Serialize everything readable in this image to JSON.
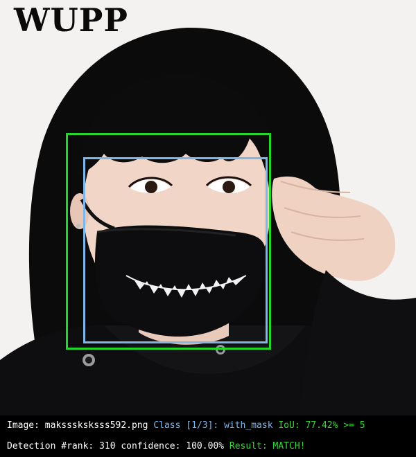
{
  "logo_text": "WUPP",
  "colors": {
    "ground_truth_box": "#22d62a",
    "prediction_box": "#7db6e8",
    "info_text": "#ffffff",
    "class_text": "#7eb8ef",
    "match_text": "#38d63a",
    "info_bar_bg": "#000000"
  },
  "info": {
    "image_label": "Image: maksssksksss592.png",
    "class_label": "Class [1/3]: with_mask",
    "iou_label": "IoU: 77.42% >= 5",
    "detection_label": "Detection #rank: 310 confidence: 100.00%",
    "result_label": "Result: MATCH!"
  }
}
